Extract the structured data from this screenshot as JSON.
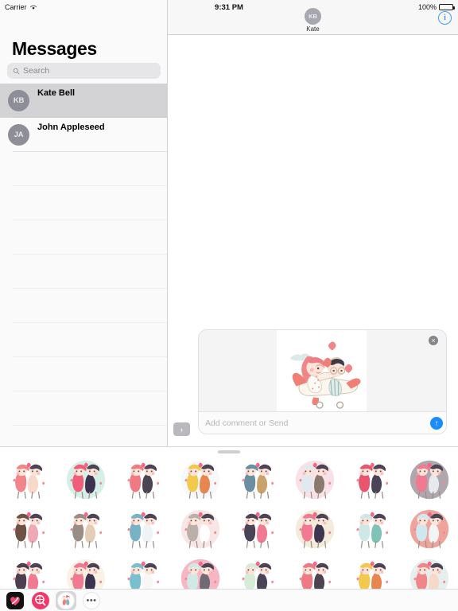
{
  "status_bar": {
    "carrier": "Carrier",
    "wifi_icon": "wifi-icon",
    "time": "9:31 PM",
    "battery_percent": "100%",
    "battery_icon": "battery-full-icon"
  },
  "sidebar": {
    "title": "Messages",
    "search": {
      "placeholder": "Search",
      "value": "",
      "icon": "search-icon"
    },
    "conversations": [
      {
        "initials": "KB",
        "name": "Kate Bell",
        "selected": true
      },
      {
        "initials": "JA",
        "name": "John Appleseed",
        "selected": false
      }
    ],
    "empty_row_count": 9
  },
  "conversation": {
    "contact_initials": "KB",
    "contact_name": "Kate",
    "info_button": {
      "label": "i",
      "icon": "info-circle-icon"
    },
    "messages": []
  },
  "compose": {
    "expand_button": {
      "label": "›",
      "icon": "chevron-right-icon"
    },
    "sticker_card": {
      "close_button": {
        "label": "×",
        "icon": "close-circle-icon"
      },
      "preview_sticker": "couple-flying-airplane-sticker"
    },
    "comment_placeholder": "Add comment or Send",
    "comment_value": "",
    "send_button": {
      "label": "↑",
      "icon": "send-arrow-up-icon"
    }
  },
  "sticker_drawer": {
    "grabber": "drag-handle",
    "columns": 8,
    "stickers": [
      {
        "name": "couple-flying-airplane",
        "a": "#f0868a",
        "b": "#cfe3e0",
        "c": "#f7d9c9"
      },
      {
        "name": "girl-giving-heart-to-boy",
        "a": "#ef5f7a",
        "b": "#b7e3d4",
        "c": "#3b3350"
      },
      {
        "name": "girl-with-bow-and-arrow",
        "a": "#ef7a84",
        "b": "#ffffff",
        "c": "#4c4450"
      },
      {
        "name": "couple-under-umbrella",
        "a": "#f2c94c",
        "b": "#eef3f4",
        "c": "#e8864f"
      },
      {
        "name": "boy-playing-saxophone",
        "a": "#6a8fa3",
        "b": "#efe3cf",
        "c": "#c9a36b"
      },
      {
        "name": "couple-in-bathtub",
        "a": "#dfe9ef",
        "b": "#f3c8d4",
        "c": "#8a7a6e"
      },
      {
        "name": "boy-with-heart-balloon",
        "a": "#e7556e",
        "b": "#f2f2f4",
        "c": "#4b4356"
      },
      {
        "name": "couple-dancing",
        "a": "#ef7a92",
        "b": "#6f5f6b",
        "c": "#e7e9ec"
      },
      {
        "name": "couple-hugging-chef-hat",
        "a": "#6e5246",
        "b": "#f6e3e6",
        "c": "#f0a8b4"
      },
      {
        "name": "bride-sketch",
        "a": "#9a8d86",
        "b": "#ffffff",
        "c": "#e3cdb7"
      },
      {
        "name": "sailor-pirate-boat",
        "a": "#77b3c4",
        "b": "#ef8272",
        "c": "#eef4f6"
      },
      {
        "name": "family-outline-sketch",
        "a": "#b9b0aa",
        "b": "#f3d0cf",
        "c": "#ffffff"
      },
      {
        "name": "two-boys-one-girl-group",
        "a": "#4b4356",
        "b": "#f3e4c9",
        "c": "#ef7a92"
      },
      {
        "name": "couple-kissing-tan-circle",
        "a": "#ef7a92",
        "b": "#e9dcc0",
        "c": "#3e3550"
      },
      {
        "name": "couple-with-gift-santa-hat",
        "a": "#cfe7e6",
        "b": "#e2574c",
        "c": "#7ec3b5"
      },
      {
        "name": "winter-couple-hats",
        "a": "#cfe7ef",
        "b": "#e2574c",
        "c": "#f4f4f6"
      },
      {
        "name": "couple-at-eiffel-tower",
        "a": "#4b3f50",
        "b": "#f4e8d4",
        "c": "#ef7a92"
      },
      {
        "name": "couple-kissing-cheek",
        "a": "#ef7a92",
        "b": "#f5e8cf",
        "c": "#3b3350"
      },
      {
        "name": "couple-kissing-on-boat",
        "a": "#79bfd0",
        "b": "#ef7a7a",
        "c": "#f7f7f8"
      },
      {
        "name": "couple-kissing-mint-circle",
        "a": "#cfe9e6",
        "b": "#ef7a92",
        "c": "#6f6a74"
      },
      {
        "name": "girl-and-boy-garden",
        "a": "#d7ecd8",
        "b": "#ef5f7a",
        "c": "#4b4356"
      },
      {
        "name": "girl-archer-back",
        "a": "#ef7a84",
        "b": "#ffffff",
        "c": "#4c4450"
      },
      {
        "name": "yellow-umbrella-couple",
        "a": "#f2c94c",
        "b": "#eef3f4",
        "c": "#e8864f"
      },
      {
        "name": "couple-flying-airplane-2",
        "a": "#f0868a",
        "b": "#cfe3e0",
        "c": "#f7d9c9"
      }
    ]
  },
  "app_toolbar": {
    "items": [
      {
        "name": "recents-app",
        "icon": "heart-app-icon",
        "label": "",
        "active": false
      },
      {
        "name": "app-store",
        "icon": "store-magnifier-icon",
        "label": "",
        "active": false
      },
      {
        "name": "sticker-pack-love",
        "icon": "sticker-pack-icon",
        "label": "",
        "active": true
      },
      {
        "name": "more-apps",
        "icon": "ellipsis-icon",
        "label": "•••",
        "active": false
      }
    ]
  },
  "colors": {
    "accent_blue": "#1a8cff",
    "info_blue": "#3d9bfb",
    "store_pink": "#f0386b",
    "selection_gray": "#d3d3d5",
    "sidebar_bg": "#fafafa"
  }
}
